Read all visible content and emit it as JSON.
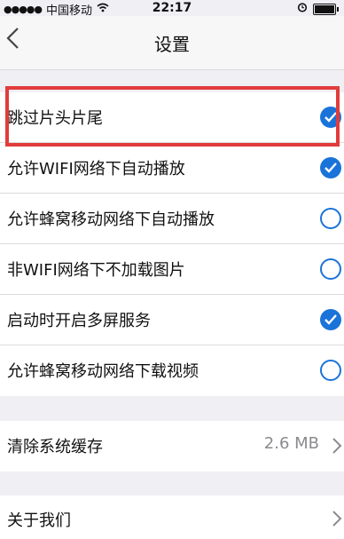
{
  "status_bar": {
    "carrier": "中国移动",
    "time": "22:17"
  },
  "nav": {
    "title": "设置"
  },
  "settings": [
    {
      "label": "跳过片头片尾",
      "checked": true
    },
    {
      "label": "允许WIFI网络下自动播放",
      "checked": true
    },
    {
      "label": "允许蜂窝移动网络下自动播放",
      "checked": false
    },
    {
      "label": "非WIFI网络下不加载图片",
      "checked": false
    },
    {
      "label": "启动时开启多屏服务",
      "checked": true
    },
    {
      "label": "允许蜂窝移动网络下载视频",
      "checked": false
    }
  ],
  "cache": {
    "label": "清除系统缓存",
    "value": "2.6 MB"
  },
  "about": {
    "label": "关于我们"
  },
  "colors": {
    "accent": "#1a73d9",
    "highlight": "#e23b3b"
  }
}
